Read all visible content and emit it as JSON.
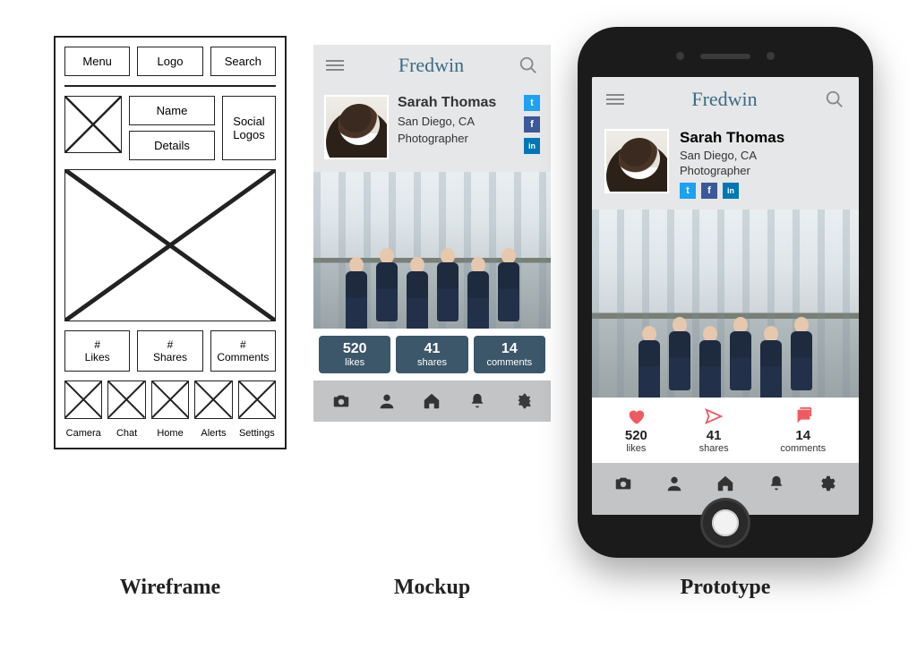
{
  "captions": {
    "wireframe": "Wireframe",
    "mockup": "Mockup",
    "prototype": "Prototype"
  },
  "wireframe": {
    "menu": "Menu",
    "logo": "Logo",
    "search": "Search",
    "name": "Name",
    "details": "Details",
    "social": "Social\nLogos",
    "stats": {
      "likes_hash": "#",
      "likes": "Likes",
      "shares_hash": "#",
      "shares": "Shares",
      "comments_hash": "#",
      "comments": "Comments"
    },
    "tabs": {
      "camera": "Camera",
      "chat": "Chat",
      "home": "Home",
      "alerts": "Alerts",
      "settings": "Settings"
    }
  },
  "mockup": {
    "appTitle": "Fredwin",
    "profile": {
      "name": "Sarah Thomas",
      "location": "San Diego, CA",
      "role": "Photographer"
    },
    "socials": {
      "twitter": "t",
      "facebook": "f",
      "linkedin": "in"
    },
    "stats": {
      "likes": {
        "value": "520",
        "label": "likes"
      },
      "shares": {
        "value": "41",
        "label": "shares"
      },
      "comments": {
        "value": "14",
        "label": "comments"
      }
    }
  },
  "prototype": {
    "appTitle": "Fredwin",
    "profile": {
      "name": "Sarah Thomas",
      "location": "San Diego, CA",
      "role": "Photographer"
    },
    "socials": {
      "twitter": "t",
      "facebook": "f",
      "linkedin": "in"
    },
    "stats": {
      "likes": {
        "value": "520",
        "label": "likes"
      },
      "shares": {
        "value": "41",
        "label": "shares"
      },
      "comments": {
        "value": "14",
        "label": "comments"
      }
    }
  }
}
